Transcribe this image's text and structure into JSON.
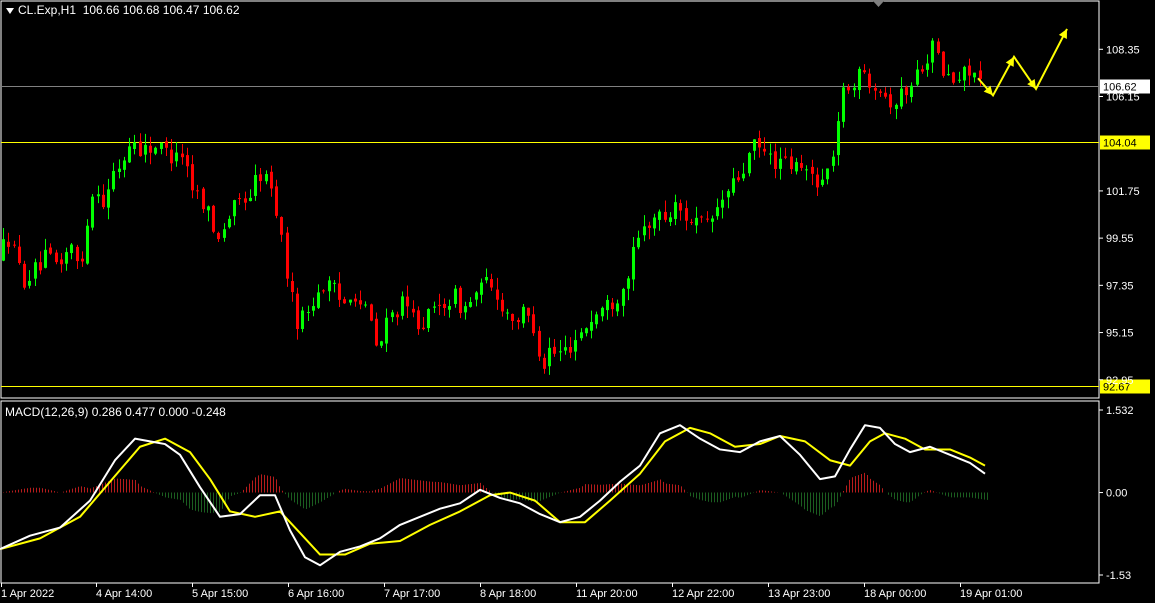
{
  "header": {
    "symbol": "CL.Exp,H1",
    "ohlc": "106.66 106.68 106.47 106.62"
  },
  "macd_header": {
    "label": "MACD(12,26,9)",
    "values": "0.286 0.477 0.000 -0.248"
  },
  "colors": {
    "bull": "#00ff00",
    "bear": "#ff0000",
    "level_line": "#ffff00",
    "signal_line": "#ffff00",
    "macd_line": "#ffffff",
    "current_price_line": "#808080",
    "arrow": "#ffff00"
  },
  "chart_data": [
    {
      "type": "candlestick",
      "symbol": "CL.Exp",
      "timeframe": "H1",
      "ylim": [
        92.1,
        110.6
      ],
      "y_ticks": [
        "108.35",
        "106.15",
        "101.75",
        "99.55",
        "97.35",
        "95.15",
        "92.95"
      ],
      "x_ticks": [
        "1 Apr 2022",
        "4 Apr 14:00",
        "5 Apr 15:00",
        "6 Apr 16:00",
        "7 Apr 17:00",
        "8 Apr 18:00",
        "11 Apr 20:00",
        "12 Apr 22:00",
        "13 Apr 23:00",
        "18 Apr 00:00",
        "19 Apr 01:00"
      ],
      "current_price": 106.62,
      "current_price_label": "106.62",
      "levels": [
        {
          "value": 104.04,
          "label": "104.04"
        },
        {
          "value": 92.67,
          "label": "92.67"
        }
      ],
      "price_path": [
        [
          0,
          98.6
        ],
        [
          6,
          99.8
        ],
        [
          14,
          98.9
        ],
        [
          22,
          97.6
        ],
        [
          32,
          97.9
        ],
        [
          45,
          98.6
        ],
        [
          58,
          98.3
        ],
        [
          70,
          99.2
        ],
        [
          80,
          98.0
        ],
        [
          88,
          100.8
        ],
        [
          96,
          102.2
        ],
        [
          104,
          101.0
        ],
        [
          112,
          102.4
        ],
        [
          122,
          103.1
        ],
        [
          132,
          104.2
        ],
        [
          142,
          103.6
        ],
        [
          152,
          103.9
        ],
        [
          162,
          103.7
        ],
        [
          170,
          103.4
        ],
        [
          178,
          103.9
        ],
        [
          186,
          103.0
        ],
        [
          194,
          101.7
        ],
        [
          202,
          101.4
        ],
        [
          208,
          100.8
        ],
        [
          214,
          99.6
        ],
        [
          222,
          100.0
        ],
        [
          230,
          100.7
        ],
        [
          240,
          101.3
        ],
        [
          250,
          101.6
        ],
        [
          258,
          102.6
        ],
        [
          266,
          102.3
        ],
        [
          274,
          101.4
        ],
        [
          282,
          99.3
        ],
        [
          290,
          96.9
        ],
        [
          298,
          95.6
        ],
        [
          306,
          96.1
        ],
        [
          314,
          96.8
        ],
        [
          322,
          97.4
        ],
        [
          332,
          97.2
        ],
        [
          342,
          96.4
        ],
        [
          352,
          97.3
        ],
        [
          360,
          96.5
        ],
        [
          368,
          96.0
        ],
        [
          378,
          94.1
        ],
        [
          386,
          95.6
        ],
        [
          394,
          96.2
        ],
        [
          402,
          96.4
        ],
        [
          412,
          95.9
        ],
        [
          422,
          95.6
        ],
        [
          434,
          96.1
        ],
        [
          444,
          96.6
        ],
        [
          454,
          96.8
        ],
        [
          464,
          96.2
        ],
        [
          474,
          96.9
        ],
        [
          486,
          97.4
        ],
        [
          496,
          96.9
        ],
        [
          506,
          96.1
        ],
        [
          516,
          95.8
        ],
        [
          526,
          96.0
        ],
        [
          536,
          95.2
        ],
        [
          542,
          93.4
        ],
        [
          548,
          94.4
        ],
        [
          556,
          94.1
        ],
        [
          564,
          94.3
        ],
        [
          572,
          94.7
        ],
        [
          582,
          95.3
        ],
        [
          592,
          95.8
        ],
        [
          602,
          96.3
        ],
        [
          612,
          96.6
        ],
        [
          622,
          97.2
        ],
        [
          632,
          98.6
        ],
        [
          640,
          99.6
        ],
        [
          648,
          100.3
        ],
        [
          656,
          100.6
        ],
        [
          666,
          100.5
        ],
        [
          676,
          101.0
        ],
        [
          686,
          100.6
        ],
        [
          696,
          100.3
        ],
        [
          706,
          100.0
        ],
        [
          716,
          100.8
        ],
        [
          726,
          101.6
        ],
        [
          736,
          102.2
        ],
        [
          744,
          102.8
        ],
        [
          752,
          103.8
        ],
        [
          762,
          103.6
        ],
        [
          772,
          103.2
        ],
        [
          782,
          103.0
        ],
        [
          792,
          102.9
        ],
        [
          802,
          102.7
        ],
        [
          812,
          102.5
        ],
        [
          822,
          102.2
        ],
        [
          830,
          102.9
        ],
        [
          836,
          104.6
        ],
        [
          842,
          106.1
        ],
        [
          848,
          106.7
        ],
        [
          856,
          107.0
        ],
        [
          864,
          107.2
        ],
        [
          872,
          106.9
        ],
        [
          880,
          106.7
        ],
        [
          888,
          106.0
        ],
        [
          896,
          105.9
        ],
        [
          904,
          106.4
        ],
        [
          912,
          106.7
        ],
        [
          920,
          107.6
        ],
        [
          928,
          108.2
        ],
        [
          934,
          108.6
        ],
        [
          940,
          107.4
        ],
        [
          948,
          107.0
        ],
        [
          956,
          106.8
        ],
        [
          964,
          107.2
        ],
        [
          970,
          107.6
        ],
        [
          976,
          107.1
        ],
        [
          982,
          106.6
        ]
      ],
      "forecast_arrow": [
        [
          978,
          107.0
        ],
        [
          993,
          106.2
        ],
        [
          1014,
          108.0
        ],
        [
          1036,
          106.5
        ],
        [
          1067,
          109.3
        ]
      ]
    },
    {
      "type": "macd",
      "params": "12,26,9",
      "ylim": [
        -1.53,
        1.532
      ],
      "y_ticks": [
        "1.532",
        "0.00",
        "-1.53"
      ],
      "series": [
        {
          "name": "MACD",
          "points": [
            [
              0,
              -1.05
            ],
            [
              30,
              -0.8
            ],
            [
              60,
              -0.65
            ],
            [
              90,
              -0.15
            ],
            [
              115,
              0.6
            ],
            [
              135,
              1.0
            ],
            [
              150,
              0.95
            ],
            [
              165,
              0.9
            ],
            [
              180,
              0.7
            ],
            [
              200,
              0.1
            ],
            [
              220,
              -0.45
            ],
            [
              240,
              -0.4
            ],
            [
              260,
              -0.05
            ],
            [
              275,
              -0.05
            ],
            [
              290,
              -0.7
            ],
            [
              305,
              -1.2
            ],
            [
              320,
              -1.35
            ],
            [
              340,
              -1.1
            ],
            [
              360,
              -1.0
            ],
            [
              380,
              -0.85
            ],
            [
              400,
              -0.6
            ],
            [
              420,
              -0.45
            ],
            [
              440,
              -0.3
            ],
            [
              460,
              -0.2
            ],
            [
              480,
              0.05
            ],
            [
              500,
              -0.1
            ],
            [
              520,
              -0.2
            ],
            [
              540,
              -0.4
            ],
            [
              560,
              -0.55
            ],
            [
              580,
              -0.45
            ],
            [
              600,
              -0.15
            ],
            [
              620,
              0.2
            ],
            [
              640,
              0.5
            ],
            [
              660,
              1.1
            ],
            [
              680,
              1.25
            ],
            [
              700,
              1.0
            ],
            [
              720,
              0.8
            ],
            [
              740,
              0.75
            ],
            [
              760,
              0.95
            ],
            [
              780,
              1.05
            ],
            [
              800,
              0.7
            ],
            [
              820,
              0.25
            ],
            [
              835,
              0.3
            ],
            [
              850,
              0.8
            ],
            [
              865,
              1.25
            ],
            [
              880,
              1.2
            ],
            [
              895,
              0.9
            ],
            [
              910,
              0.75
            ],
            [
              930,
              0.85
            ],
            [
              950,
              0.7
            ],
            [
              970,
              0.55
            ],
            [
              985,
              0.35
            ]
          ]
        },
        {
          "name": "Signal",
          "points": [
            [
              0,
              -1.05
            ],
            [
              40,
              -0.85
            ],
            [
              80,
              -0.45
            ],
            [
              110,
              0.2
            ],
            [
              140,
              0.85
            ],
            [
              165,
              1.0
            ],
            [
              190,
              0.75
            ],
            [
              210,
              0.25
            ],
            [
              230,
              -0.35
            ],
            [
              255,
              -0.45
            ],
            [
              280,
              -0.35
            ],
            [
              300,
              -0.75
            ],
            [
              320,
              -1.15
            ],
            [
              345,
              -1.15
            ],
            [
              370,
              -0.95
            ],
            [
              400,
              -0.9
            ],
            [
              430,
              -0.6
            ],
            [
              460,
              -0.35
            ],
            [
              490,
              -0.05
            ],
            [
              510,
              0.0
            ],
            [
              535,
              -0.15
            ],
            [
              560,
              -0.55
            ],
            [
              585,
              -0.55
            ],
            [
              610,
              -0.15
            ],
            [
              640,
              0.35
            ],
            [
              665,
              0.95
            ],
            [
              690,
              1.2
            ],
            [
              710,
              1.1
            ],
            [
              735,
              0.85
            ],
            [
              760,
              0.9
            ],
            [
              780,
              1.05
            ],
            [
              805,
              0.95
            ],
            [
              830,
              0.6
            ],
            [
              850,
              0.5
            ],
            [
              870,
              0.95
            ],
            [
              885,
              1.1
            ],
            [
              905,
              1.0
            ],
            [
              925,
              0.8
            ],
            [
              950,
              0.8
            ],
            [
              970,
              0.65
            ],
            [
              985,
              0.5
            ]
          ]
        }
      ]
    }
  ]
}
